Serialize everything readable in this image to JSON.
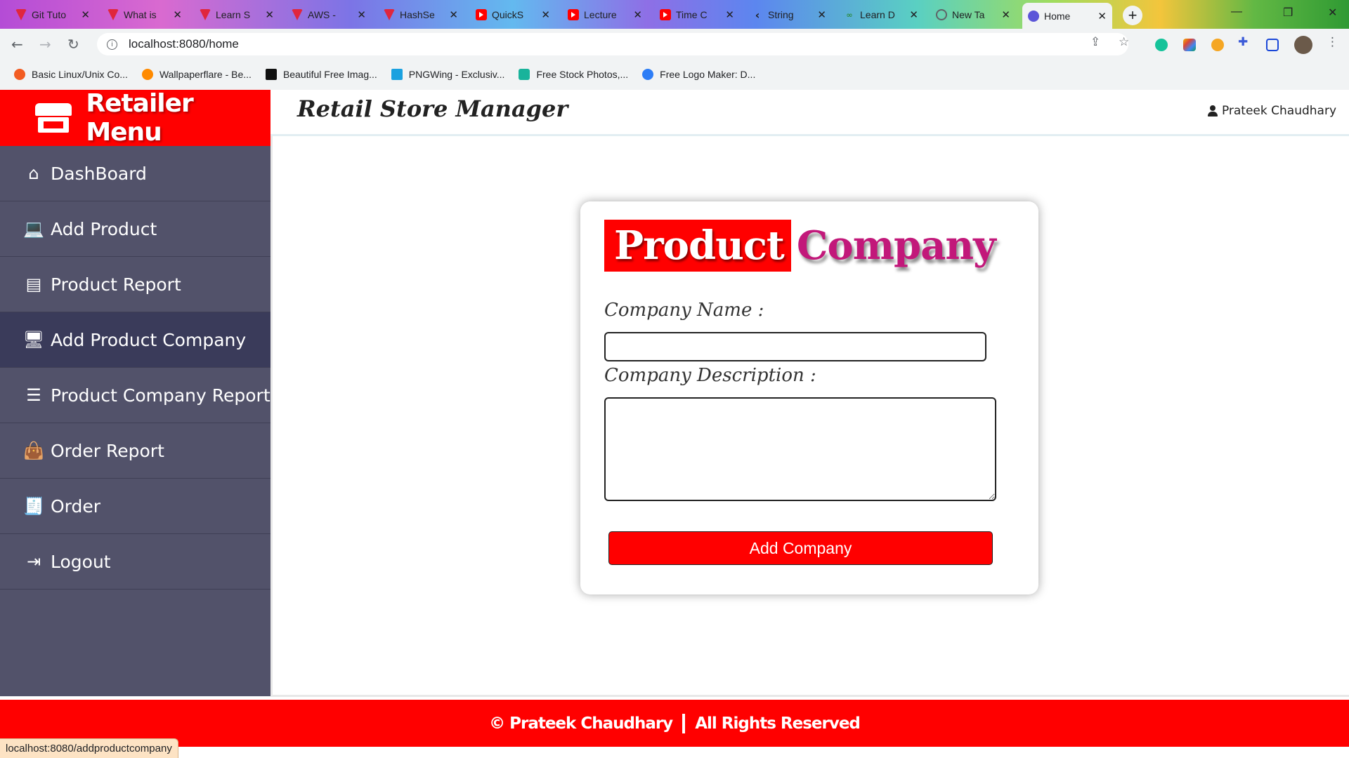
{
  "browser": {
    "tabs": [
      {
        "title": "Git Tuto",
        "icon": "vivaldi-icon"
      },
      {
        "title": "What is",
        "icon": "vivaldi-icon"
      },
      {
        "title": "Learn S",
        "icon": "vivaldi-icon"
      },
      {
        "title": "AWS -",
        "icon": "vivaldi-icon"
      },
      {
        "title": "HashSe",
        "icon": "vivaldi-icon"
      },
      {
        "title": "QuickS",
        "icon": "youtube-icon"
      },
      {
        "title": "Lecture",
        "icon": "youtube-icon"
      },
      {
        "title": "Time C",
        "icon": "youtube-icon"
      },
      {
        "title": "String",
        "icon": "leetcode-icon"
      },
      {
        "title": "Learn D",
        "icon": "gfg-icon"
      },
      {
        "title": "New Ta",
        "icon": "globe-icon"
      },
      {
        "title": "Home",
        "icon": "home-globe-icon"
      }
    ],
    "close_glyph": "✕",
    "url": "localhost:8080/home",
    "bookmarks": [
      {
        "label": "Basic Linux/Unix Co...",
        "color": "#f25c22"
      },
      {
        "label": "Wallpaperflare - Be...",
        "color": "#ff8a00"
      },
      {
        "label": "Beautiful Free Imag...",
        "color": "#111111"
      },
      {
        "label": "PNGWing - Exclusiv...",
        "color": "#1aa1e0"
      },
      {
        "label": "Free Stock Photos,...",
        "color": "#19b39b"
      },
      {
        "label": "Free Logo Maker: D...",
        "color": "#2d7df6"
      }
    ],
    "status_url": "localhost:8080/addproductcompany"
  },
  "sidebar": {
    "brand": "Retailer Menu",
    "items": [
      {
        "label": "DashBoard",
        "icon": "home-icon"
      },
      {
        "label": "Add Product",
        "icon": "laptop-icon"
      },
      {
        "label": "Product Report",
        "icon": "list-alt-icon"
      },
      {
        "label": "Add Product Company",
        "icon": "desktop-icon",
        "active": true
      },
      {
        "label": "Product Company Report",
        "icon": "list-icon"
      },
      {
        "label": "Order Report",
        "icon": "shopping-bag-icon"
      },
      {
        "label": "Order",
        "icon": "receipt-icon"
      },
      {
        "label": "Logout",
        "icon": "sign-out-icon"
      }
    ]
  },
  "header": {
    "title": "Retail Store Manager",
    "user": "Prateek Chaudhary"
  },
  "form": {
    "title_part1": "Product",
    "title_part2": "Company",
    "company_name_label": "Company Name :",
    "company_name_value": "",
    "company_description_label": "Company Description :",
    "company_description_value": "",
    "submit_label": "Add Company"
  },
  "footer": {
    "copyright": "© Prateek Chaudhary",
    "rights": "All Rights Reserved"
  },
  "colors": {
    "brand_red": "#ff0000",
    "sidebar_bg": "#52526a",
    "sidebar_active": "#3a3b5a",
    "title_accent": "#c2187a"
  }
}
